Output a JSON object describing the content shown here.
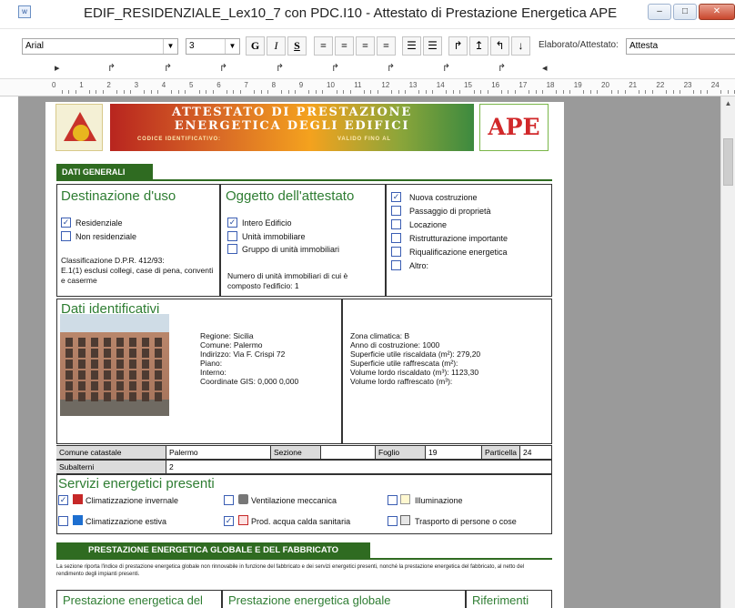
{
  "window": {
    "title": "EDIF_RESIDENZIALE_Lex10_7 con PDC.I10 - Attestato di Prestazione Energetica APE",
    "minimize": "–",
    "maximize": "□",
    "close": "✕"
  },
  "toolbar": {
    "font_name": "Arial",
    "font_size": "3",
    "bold": "G",
    "italic": "I",
    "underline": "S",
    "mode_label": "Elaborato/Attestato:",
    "mode_value": "Attesta"
  },
  "ruler": {
    "numbers": [
      "0",
      "1",
      "2",
      "3",
      "4",
      "5",
      "6",
      "7",
      "8",
      "9",
      "10",
      "11",
      "12",
      "13",
      "14",
      "15",
      "16",
      "17",
      "18",
      "19",
      "20",
      "21",
      "22",
      "23",
      "24"
    ]
  },
  "banner": {
    "line1": "ATTESTATO DI PRESTAZIONE",
    "line2": "ENERGETICA DEGLI EDIFICI",
    "sub_left": "CODICE IDENTIFICATIVO:",
    "sub_right": "VALIDO FINO AL",
    "ape_logo": "APE"
  },
  "dati_generali": {
    "tab": "DATI GENERALI",
    "destinazione": {
      "title": "Destinazione d'uso",
      "residenziale": "Residenziale",
      "non_residenziale": "Non residenziale",
      "classificazione": "Classificazione D.P.R. 412/93:",
      "classificazione_value": "E.1(1) esclusi collegi, case di pena, conventi e caserme"
    },
    "oggetto": {
      "title": "Oggetto dell'attestato",
      "intero": "Intero Edificio",
      "unita": "Unità immobiliare",
      "gruppo": "Gruppo di unità immobiliari",
      "numero": "Numero di unità immobiliari di cui è composto l'edificio: 1"
    },
    "motivo": {
      "nuova": "Nuova costruzione",
      "passaggio": "Passaggio di proprietà",
      "locazione": "Locazione",
      "ristrutturazione": "Ristrutturazione importante",
      "riqualificazione": "Riqualificazione energetica",
      "altro": "Altro:"
    }
  },
  "identificativi": {
    "title": "Dati identificativi",
    "regione": "Regione: Sicilia",
    "comune": "Comune: Palermo",
    "indirizzo": "Indirizzo: Via F. Crispi 72",
    "piano": "Piano:",
    "interno": "Interno:",
    "gis": "Coordinate GIS: 0,000 0,000",
    "zona": "Zona climatica: B",
    "anno": "Anno di costruzione: 1000",
    "sup_risc": "Superficie utile riscaldata (m²): 279,20",
    "sup_raff": "Superficie utile raffrescata (m²):",
    "vol_risc": "Volume lordo riscaldato (m³): 1123,30",
    "vol_raff": "Volume lordo raffrescato (m³):"
  },
  "catasto": {
    "comune_label": "Comune catastale",
    "comune_value": "Palermo",
    "sezione_label": "Sezione",
    "sezione_value": "",
    "foglio_label": "Foglio",
    "foglio_value": "19",
    "particella_label": "Particella",
    "particella_value": "24",
    "subalterni_label": "Subalterni",
    "subalterni_value": "2"
  },
  "servizi": {
    "title": "Servizi energetici presenti",
    "inv": "Climatizzazione invernale",
    "vent": "Ventilazione meccanica",
    "ill": "Illuminazione",
    "est": "Climatizzazione estiva",
    "acs": "Prod. acqua calda sanitaria",
    "trasp": "Trasporto di persone o cose"
  },
  "prestazione": {
    "tab": "PRESTAZIONE ENERGETICA GLOBALE E DEL FABBRICATO",
    "desc": "La sezione riporta l'indice di prestazione energetica globale non rinnovabile in funzione del fabbricato e dei servizi energetici presenti, nonché la prestazione energetica del fabbricato, al netto del rendimento degli impianti presenti.",
    "col1": "Prestazione energetica del",
    "col2": "Prestazione energetica globale",
    "col3": "Riferimenti"
  }
}
